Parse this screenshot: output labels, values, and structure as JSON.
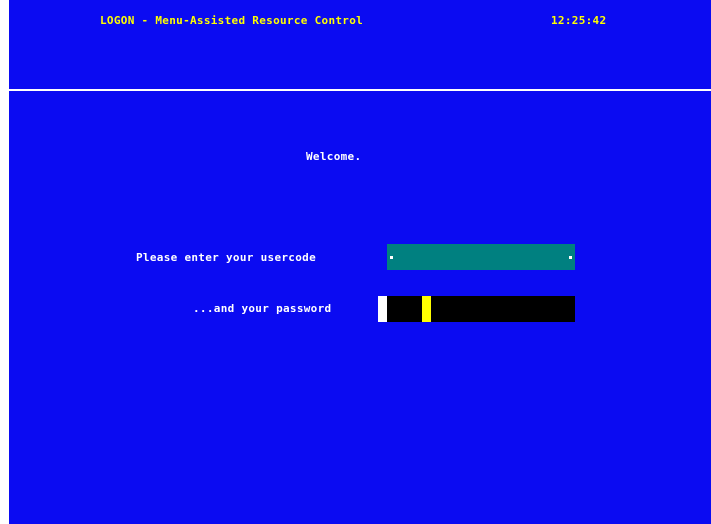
{
  "header": {
    "title": "LOGON - Menu-Assisted Resource Control",
    "clock": "12:25:42"
  },
  "main": {
    "welcome": "Welcome.",
    "usercode_label": "Please enter your usercode",
    "usercode_value": "",
    "password_label": "...and your password",
    "password_value": ""
  },
  "colors": {
    "background": "#0b0bf2",
    "header_text": "#ffff00",
    "body_text": "#ffffff",
    "usercode_field": "#008080",
    "password_field": "#000000",
    "cursor": "#ffff00"
  }
}
